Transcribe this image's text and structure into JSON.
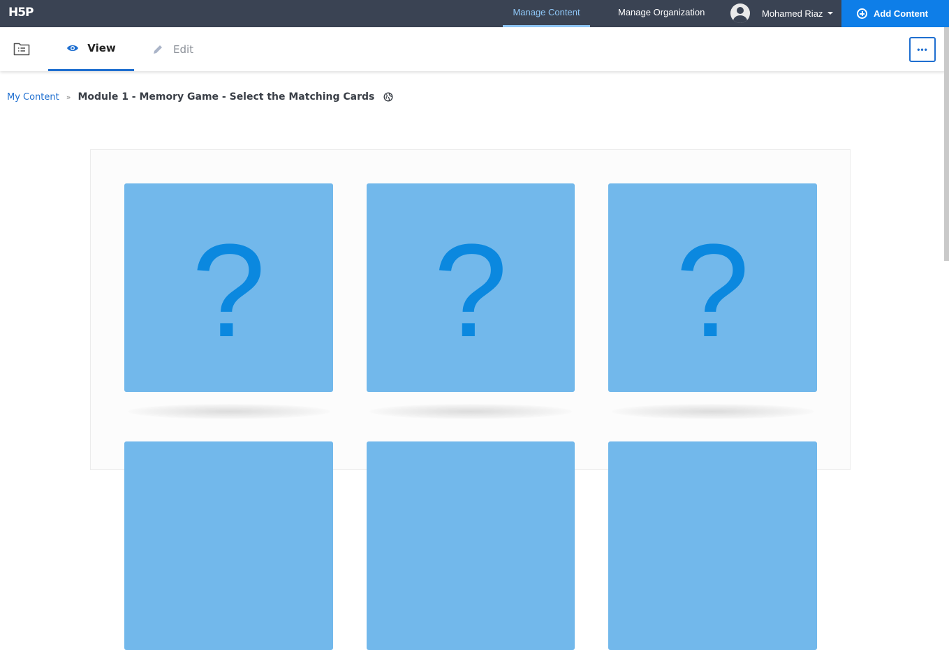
{
  "topbar": {
    "logo": "H5P",
    "nav": {
      "manage_content": "Manage Content",
      "manage_organization": "Manage Organization"
    },
    "user": {
      "name": "Mohamed Riaz",
      "avatar_icon": "user-avatar-icon"
    },
    "add_content": "Add Content",
    "colors": {
      "bar": "#3a4353",
      "active": "#8fc7f7",
      "add_button": "#0e7ee8"
    }
  },
  "tabs": {
    "view": "View",
    "edit": "Edit",
    "active": "View",
    "more_label": "•••"
  },
  "breadcrumb": {
    "root": "My Content",
    "separator": "»",
    "title": "Module 1 - Memory Game - Select the Matching Cards"
  },
  "memory_game": {
    "card_symbol": "?",
    "card_color": "#72b8eb",
    "symbol_color": "#0b88df",
    "cards_visible": 6
  }
}
